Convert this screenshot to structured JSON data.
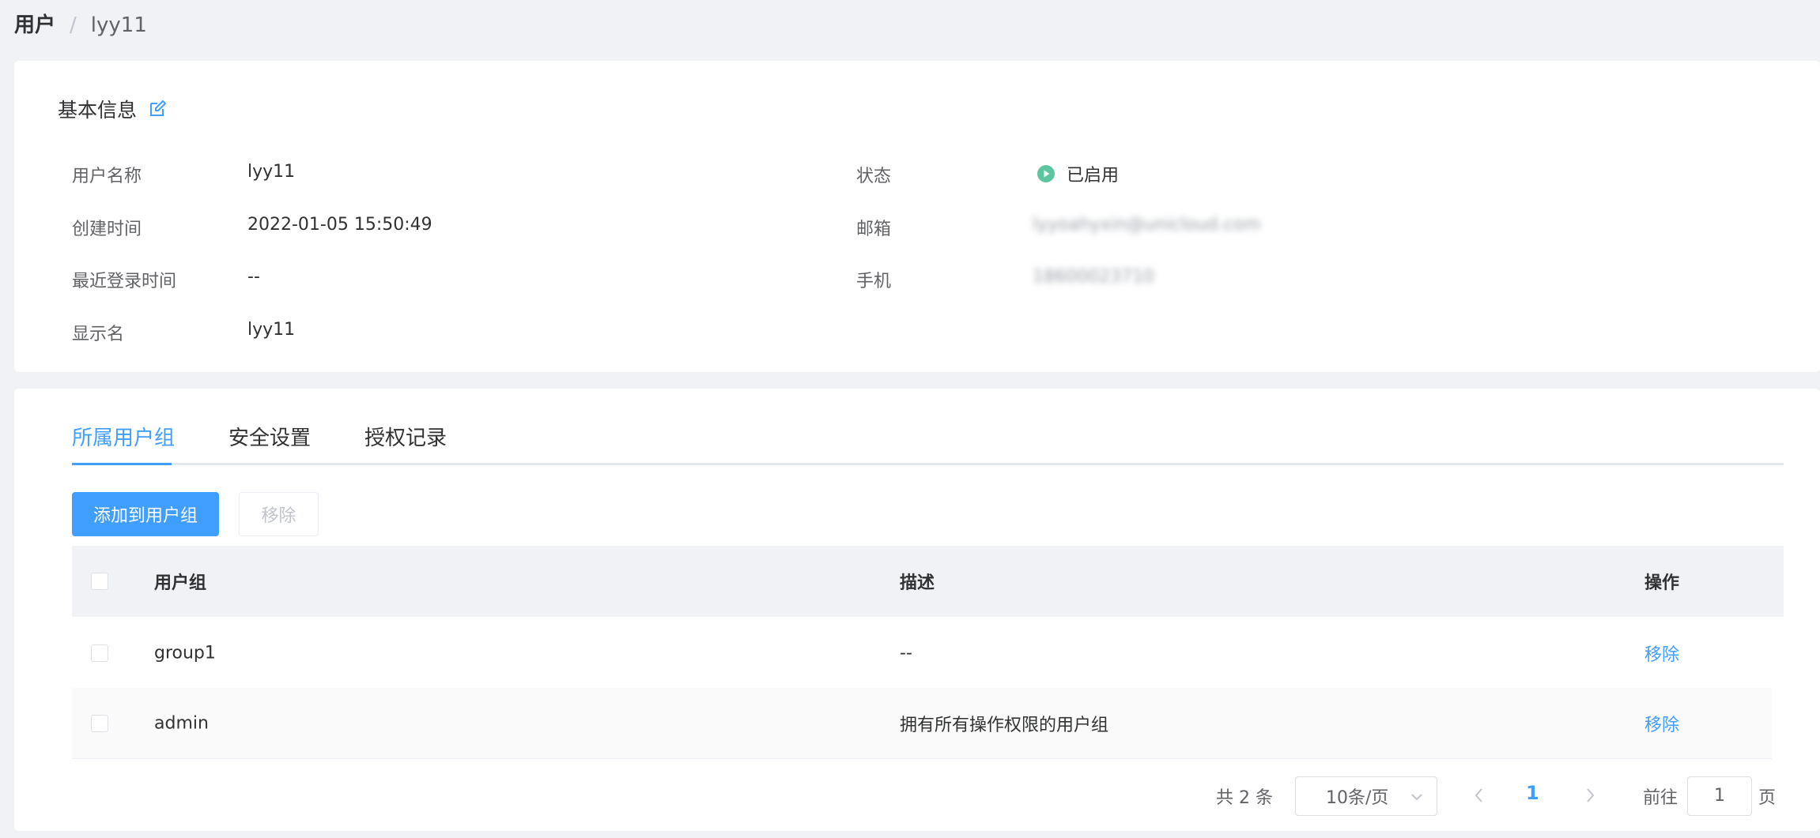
{
  "breadcrumb": {
    "root": "用户",
    "separator": "/",
    "current": "lyy11"
  },
  "basic_info": {
    "title": "基本信息",
    "edit_icon": "edit-icon",
    "fields": {
      "username": {
        "label": "用户名称",
        "value": "lyy11"
      },
      "created_at": {
        "label": "创建时间",
        "value": "2022-01-05 15:50:49"
      },
      "last_login": {
        "label": "最近登录时间",
        "value": "--"
      },
      "display_name": {
        "label": "显示名",
        "value": "lyy11"
      },
      "status": {
        "label": "状态",
        "value": "已启用",
        "icon": "play-circle-icon",
        "color": "#5cc6a0"
      },
      "email": {
        "label": "邮箱",
        "value": "lyyoahyxin@unicloud.com"
      },
      "phone": {
        "label": "手机",
        "value": "18600023710"
      }
    }
  },
  "tabs": [
    {
      "label": "所属用户组",
      "active": true
    },
    {
      "label": "安全设置",
      "active": false
    },
    {
      "label": "授权记录",
      "active": false
    }
  ],
  "toolbar": {
    "add_label": "添加到用户组",
    "remove_label": "移除"
  },
  "table": {
    "columns": [
      "用户组",
      "描述",
      "操作"
    ],
    "rows": [
      {
        "group": "group1",
        "description": "--",
        "action": "移除"
      },
      {
        "group": "admin",
        "description": "拥有所有操作权限的用户组",
        "action": "移除"
      }
    ]
  },
  "pagination": {
    "total_text": "共 2 条",
    "page_size": "10条/页",
    "current_page": "1",
    "goto_prefix": "前往",
    "goto_value": "1",
    "goto_suffix": "页"
  },
  "colors": {
    "primary": "#409eff",
    "background": "#f0f2f5",
    "status_enabled": "#5cc6a0"
  }
}
